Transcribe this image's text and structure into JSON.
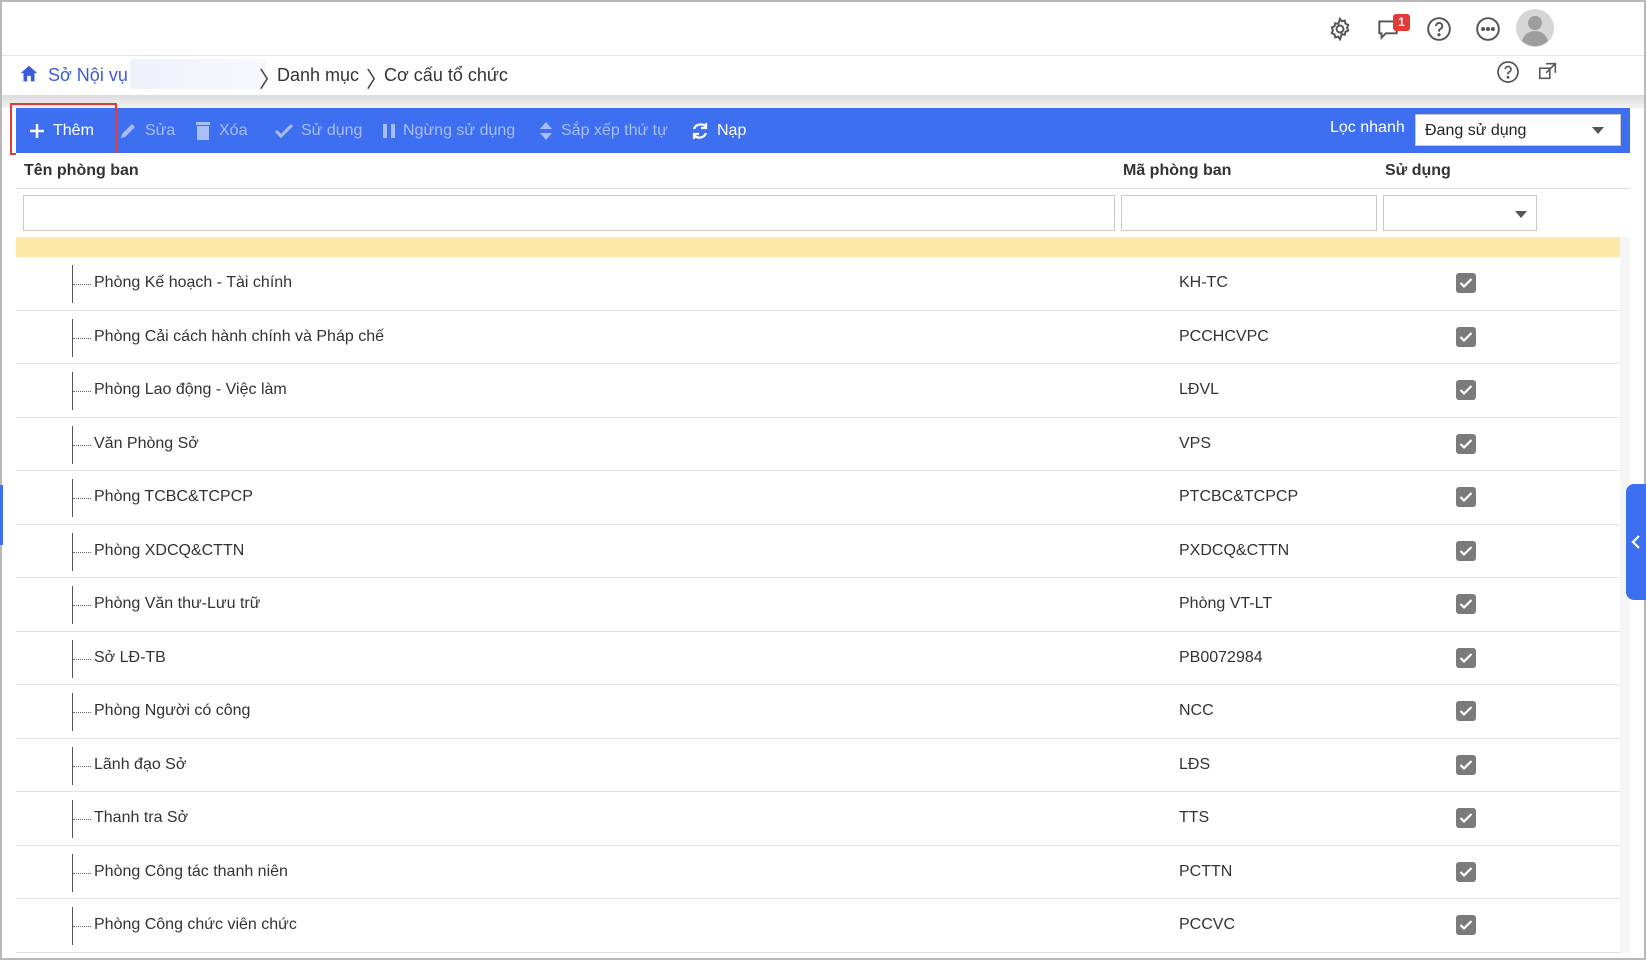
{
  "topbar": {
    "notification_count": "1",
    "icons": [
      "settings-icon",
      "chat-icon",
      "help-icon",
      "more-icon",
      "avatar"
    ]
  },
  "breadcrumb": {
    "home": "Sở Nội vụ",
    "items": [
      "Danh mục",
      "Cơ cấu tổ chức"
    ]
  },
  "toolbar": {
    "add": "Thêm",
    "edit": "Sửa",
    "delete": "Xóa",
    "use": "Sử dụng",
    "stop_use": "Ngừng sử dụng",
    "sort": "Sắp xếp thứ tự",
    "reload": "Nạp",
    "quick_filter_label": "Lọc nhanh",
    "quick_filter_value": "Đang sử dụng"
  },
  "table": {
    "headers": {
      "name": "Tên phòng ban",
      "code": "Mã phòng ban",
      "in_use": "Sử dụng"
    },
    "rows": [
      {
        "name": "Phòng Kế hoạch - Tài chính",
        "code": "KH-TC",
        "in_use": true
      },
      {
        "name": "Phòng Cải cách hành chính và Pháp chế",
        "code": "PCCHCVPC",
        "in_use": true
      },
      {
        "name": "Phòng Lao động - Việc làm",
        "code": "LĐVL",
        "in_use": true
      },
      {
        "name": "Văn Phòng Sở",
        "code": "VPS",
        "in_use": true
      },
      {
        "name": "Phòng TCBC&TCPCP",
        "code": "PTCBC&TCPCP",
        "in_use": true
      },
      {
        "name": "Phòng XDCQ&CTTN",
        "code": "PXDCQ&CTTN",
        "in_use": true
      },
      {
        "name": "Phòng Văn thư-Lưu trữ",
        "code": "Phòng VT-LT",
        "in_use": true
      },
      {
        "name": "Sở LĐ-TB",
        "code": "PB0072984",
        "in_use": true
      },
      {
        "name": "Phòng Người có công",
        "code": "NCC",
        "in_use": true
      },
      {
        "name": "Lãnh đạo Sở",
        "code": "LĐS",
        "in_use": true
      },
      {
        "name": "Thanh tra Sở",
        "code": "TTS",
        "in_use": true
      },
      {
        "name": "Phòng Công tác thanh niên",
        "code": "PCTTN",
        "in_use": true
      },
      {
        "name": "Phòng Công chức viên chức",
        "code": "PCCVC",
        "in_use": true
      }
    ]
  },
  "colors": {
    "toolbar_bg": "#3e6ff0",
    "selected_row": "#fde9a9",
    "highlight_border": "#e53935"
  }
}
